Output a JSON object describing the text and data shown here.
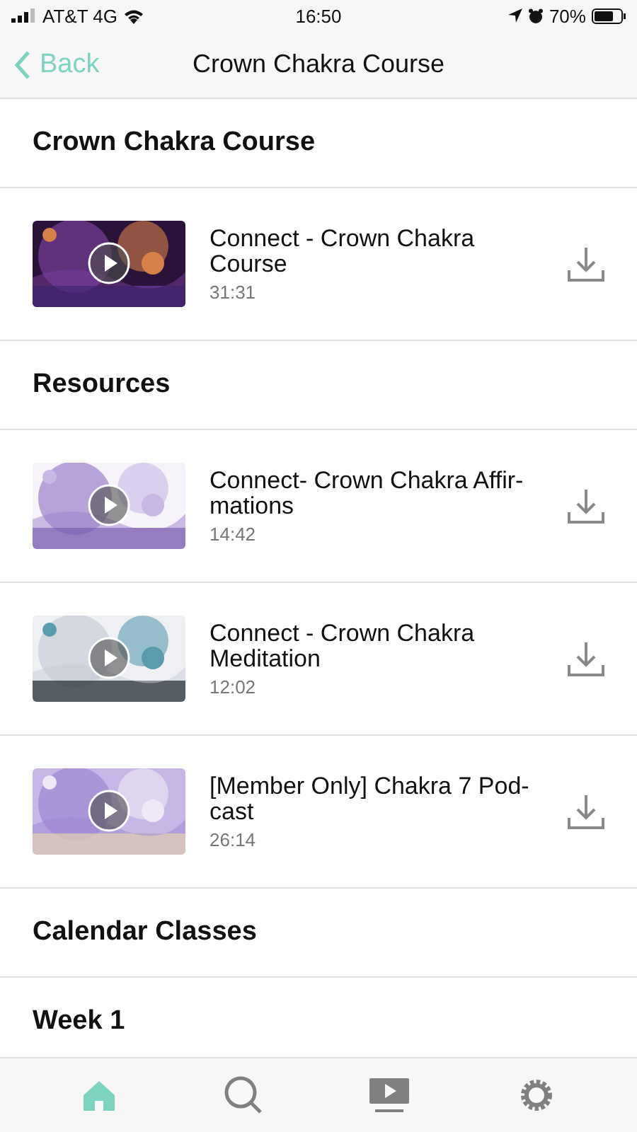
{
  "status_bar": {
    "carrier": "AT&T 4G",
    "time": "16:50",
    "battery": "70%"
  },
  "nav": {
    "back": "Back",
    "title": "Crown Chakra Course"
  },
  "sections": [
    {
      "title": "Crown Chakra Course",
      "items": [
        {
          "title": "Connect - Crown Chakra Course",
          "duration": "31:31"
        }
      ]
    },
    {
      "title": "Resources",
      "items": [
        {
          "title": "Connect- Crown Chakra Affir-mations",
          "duration": "14:42"
        },
        {
          "title": "Connect - Crown Chakra Meditation",
          "duration": "12:02"
        },
        {
          "title": "[Member Only] Chakra 7 Pod-cast",
          "duration": "26:14"
        }
      ]
    },
    {
      "title": "Calendar Classes"
    },
    {
      "title": "Week 1"
    }
  ],
  "tab_bar": [
    {
      "kind": "home",
      "selected": true
    },
    {
      "kind": "search",
      "selected": false
    },
    {
      "kind": "video",
      "selected": false
    },
    {
      "kind": "settings",
      "selected": false
    }
  ]
}
